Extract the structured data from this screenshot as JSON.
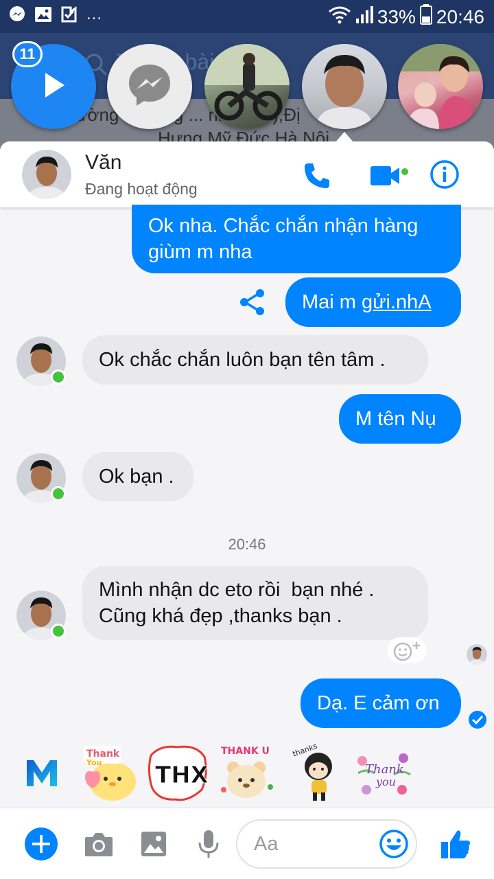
{
  "status_bar": {
    "left_more": "...",
    "battery_percent": "33%",
    "time": "20:46"
  },
  "background": {
    "search_placeholder": "Tìm ... bài ... và...",
    "line1": "ường ... hàng ... rinh ... u),Đị",
    "line2": "Hưng Mỹ Đức Hà Nội"
  },
  "chat_heads": {
    "badge_count": "11"
  },
  "header": {
    "name": "Văn",
    "status": "Đang hoạt động"
  },
  "messages": {
    "m1_line1": "Ok nha. Chắc chắn nhận hàng",
    "m1_line2": "giùm m nha",
    "m2_prefix": "Mai m ",
    "m2_link": "gửi.nhA",
    "m3": "Ok chắc chắn luôn bạn tên tâm .",
    "m4": "M tên Nụ",
    "m5": "Ok bạn .",
    "timestamp": "20:46",
    "m6_line1": "Mình nhận dc eto rồi  bạn nhé .",
    "m6_line2": "Cũng khá đẹp ,thanks bạn .",
    "m7": "Dạ. E cảm ơn"
  },
  "composer": {
    "placeholder": "Aa"
  },
  "colors": {
    "messenger_blue": "#0084ff",
    "online_green": "#44c33b",
    "incoming_bubble": "#e9e9eb"
  },
  "icons": [
    "messenger-icon",
    "play-icon",
    "phone-icon",
    "video-icon",
    "info-icon",
    "share-icon",
    "add-reaction-icon",
    "delivered-check-icon",
    "plus-icon",
    "camera-icon",
    "image-icon",
    "mic-icon",
    "emoji-icon",
    "thumbs-up-icon"
  ]
}
